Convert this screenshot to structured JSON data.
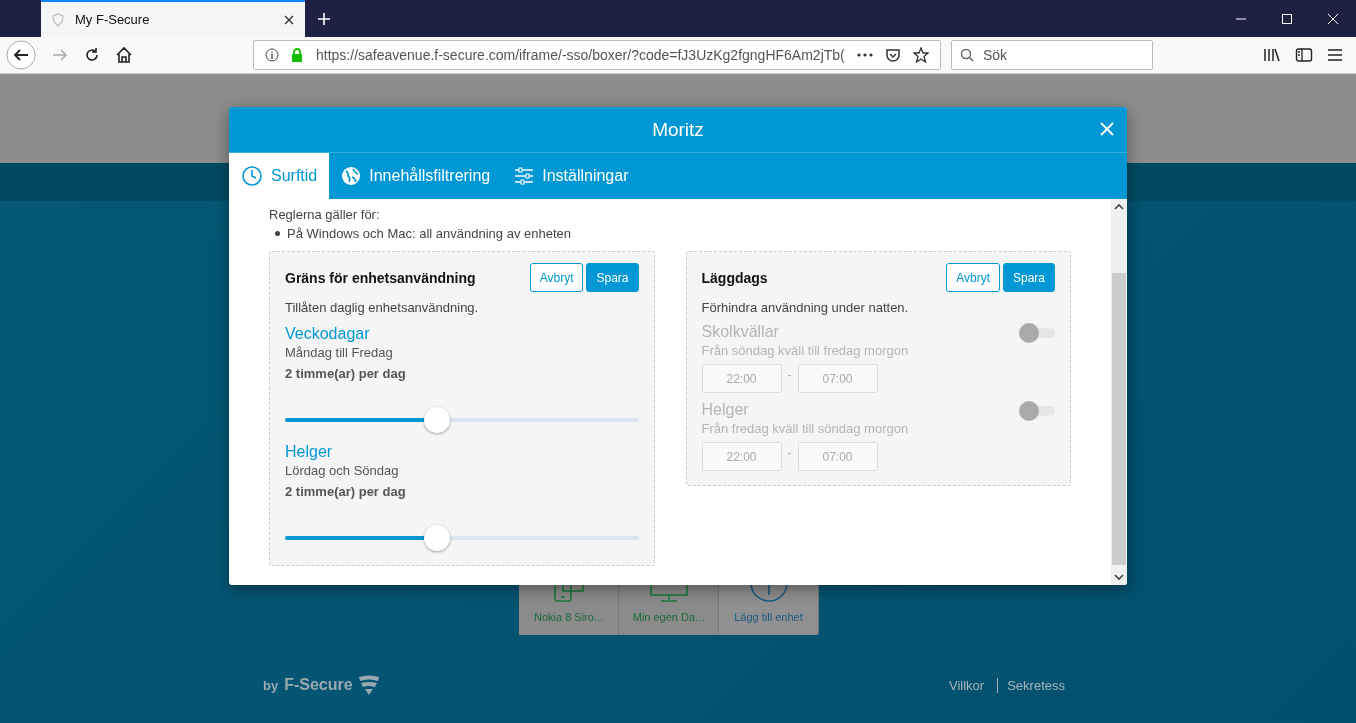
{
  "browser": {
    "tab_title": "My F-Secure",
    "url": "https://safeavenue.f-secure.com/iframe/-sso/boxer/?code=fJ3UzKg2fgngHF6Am2jTb(",
    "search": {
      "placeholder": "Sök"
    }
  },
  "page": {
    "devices": [
      {
        "name": "Nokia 8 Siro...",
        "kind": "phone"
      },
      {
        "name": "Min egen Da...",
        "kind": "computer"
      },
      {
        "name": "Lägg till enhet",
        "kind": "add"
      }
    ],
    "footer": {
      "brand_prefix": "by",
      "brand": "F-Secure",
      "links": [
        "Villkor",
        "Sekretess"
      ]
    }
  },
  "dialog": {
    "title": "Moritz",
    "tabs": [
      {
        "label": "Surftid",
        "kind": "clock",
        "selected": true
      },
      {
        "label": "Innehållsfiltrering",
        "kind": "globe",
        "selected": false
      },
      {
        "label": "Inställningar",
        "kind": "sliders",
        "selected": false
      }
    ],
    "rules_heading": "Reglerna gäller för:",
    "rules": [
      "På Windows och Mac: all användning av enheten"
    ],
    "panels": [
      {
        "kind": "usage",
        "title": "Gräns för enhetsanvändning",
        "cancel": "Avbryt",
        "save": "Spara",
        "description": "Tillåten daglig enhetsanvändning.",
        "limits": [
          {
            "name": "Veckodagar",
            "days": "Måndag till Fredag",
            "amount": "2 timme(ar) per dag",
            "level": 0.43
          },
          {
            "name": "Helger",
            "days": "Lördag och Söndag",
            "amount": "2 timme(ar) per dag",
            "level": 0.43
          }
        ]
      },
      {
        "kind": "bedtime",
        "title": "Läggdags",
        "cancel": "Avbryt",
        "save": "Spara",
        "description": "Förhindra användning under natten.",
        "schedules": [
          {
            "name": "Skolkvällar",
            "days": "Från söndag kväll till fredag morgon",
            "from": "22:00",
            "separator": "-",
            "to": "07:00",
            "on": false
          },
          {
            "name": "Helger",
            "days": "Från fredag kväll till söndag morgon",
            "from": "22:00",
            "separator": "-",
            "to": "07:00",
            "on": false
          }
        ]
      }
    ]
  }
}
